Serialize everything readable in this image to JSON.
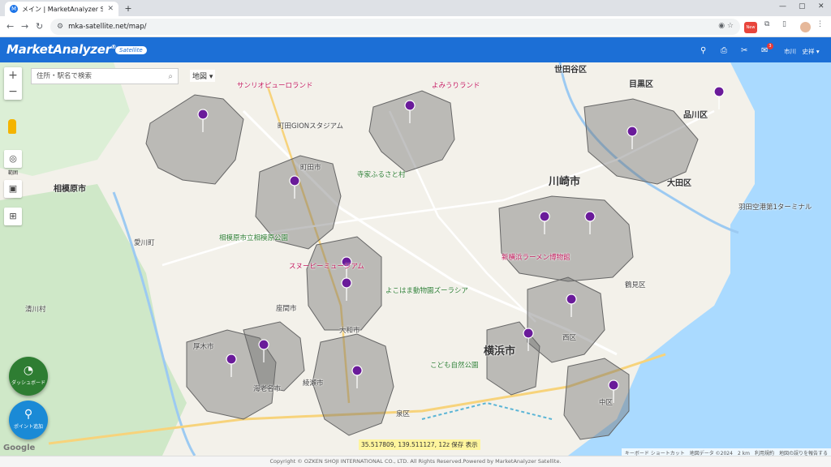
{
  "browser": {
    "tab_title": "メイン | MarketAnalyzer Satellite",
    "url": "mka-satellite.net/map/",
    "profile_badge": "New"
  },
  "app": {
    "logo": "MarketAnalyzer",
    "logo_mark": "®",
    "logo_sub": "Satellite",
    "user_name": "市川　史祥 ▾",
    "notification_count": "3"
  },
  "map_controls": {
    "search_placeholder": "住所・駅名で検索",
    "map_type": "地図 ▾",
    "zoom_in": "+",
    "zoom_out": "−",
    "tool_area": "範囲"
  },
  "fabs": {
    "dashboard": "ダッシュボード",
    "points": "ポイント追加"
  },
  "map_labels": {
    "cities": [
      {
        "text": "川崎市"
      },
      {
        "text": "横浜市"
      },
      {
        "text": "相模原市"
      },
      {
        "text": "大田区"
      },
      {
        "text": "品川区"
      },
      {
        "text": "目黒区"
      },
      {
        "text": "世田谷区"
      },
      {
        "text": "町田市"
      },
      {
        "text": "大和市"
      },
      {
        "text": "厚木市"
      },
      {
        "text": "海老名市"
      },
      {
        "text": "綾瀬市"
      },
      {
        "text": "座間市"
      },
      {
        "text": "愛川町"
      },
      {
        "text": "清川村"
      },
      {
        "text": "中区"
      },
      {
        "text": "泉区"
      },
      {
        "text": "西区"
      },
      {
        "text": "鶴見区"
      }
    ],
    "pois": [
      {
        "text": "サンリオピューロランド"
      },
      {
        "text": "よみうりランド"
      },
      {
        "text": "町田GIONスタジアム"
      },
      {
        "text": "スヌーピーミュージアム"
      },
      {
        "text": "よこはま動物園ズーラシア"
      },
      {
        "text": "新横浜ラーメン博物館"
      },
      {
        "text": "羽田空港第1ターミナル"
      },
      {
        "text": "寺家ふるさと村"
      },
      {
        "text": "こども自然公園"
      },
      {
        "text": "相模原市立相模原公園"
      }
    ]
  },
  "coords": "35.517809, 139.511127, 12z 保存 表示",
  "gmap_bar": "キーボード ショートカット　地図データ ©2024　2 km　利用規約　地図の誤りを報告する",
  "google_logo": "Google",
  "footer": "Copyright © OZKEN SHOJI INTERNATIONAL CO., LTD. All Rights Reserved.Powered by MarketAnalyzer Satellite."
}
